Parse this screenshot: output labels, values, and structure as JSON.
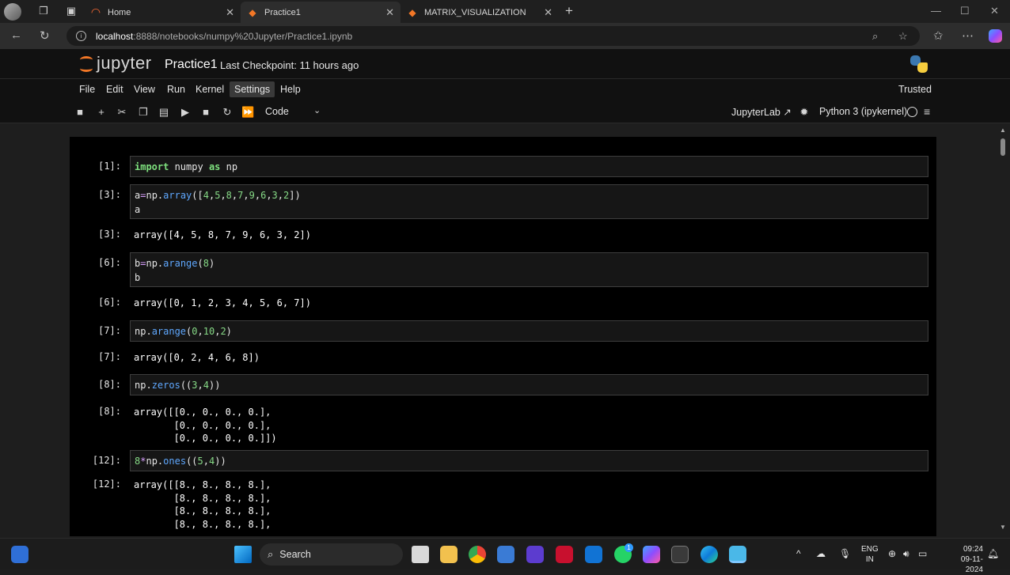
{
  "browser": {
    "tabs": [
      {
        "label": "Home",
        "icon": "edge-tab-icon"
      },
      {
        "label": "Practice1",
        "icon": "jupyter-notebook-icon"
      },
      {
        "label": "MATRIX_VISUALIZATION",
        "icon": "jupyter-notebook-icon"
      }
    ],
    "url_host": "localhost",
    "url_rest": ":8888/notebooks/numpy%20Jupyter/Practice1.ipynb"
  },
  "jupyter": {
    "logo_text": "jupyter",
    "notebook_title": "Practice1",
    "checkpoint": "Last Checkpoint: 11 hours ago",
    "menu": [
      "File",
      "Edit",
      "View",
      "Run",
      "Kernel",
      "Settings",
      "Help"
    ],
    "trusted": "Trusted",
    "cell_type": "Code",
    "jupyterlab_label": "JupyterLab",
    "kernel_name": "Python 3 (ipykernel)"
  },
  "cells": [
    {
      "prompt": "[1]:",
      "code": [
        "import numpy as np"
      ],
      "out_prompt": "",
      "output": ""
    },
    {
      "prompt": "[3]:",
      "code": [
        "a=np.array([4,5,8,7,9,6,3,2])",
        "a"
      ],
      "out_prompt": "[3]:",
      "output": "array([4, 5, 8, 7, 9, 6, 3, 2])"
    },
    {
      "prompt": "[6]:",
      "code": [
        "b=np.arange(8)",
        "b"
      ],
      "out_prompt": "[6]:",
      "output": "array([0, 1, 2, 3, 4, 5, 6, 7])"
    },
    {
      "prompt": "[7]:",
      "code": [
        "np.arange(0,10,2)"
      ],
      "out_prompt": "[7]:",
      "output": "array([0, 2, 4, 6, 8])"
    },
    {
      "prompt": "[8]:",
      "code": [
        "np.zeros((3,4))"
      ],
      "out_prompt": "[8]:",
      "output": "array([[0., 0., 0., 0.],\n       [0., 0., 0., 0.],\n       [0., 0., 0., 0.]])"
    },
    {
      "prompt": "[12]:",
      "code": [
        "8*np.ones((5,4))"
      ],
      "out_prompt": "[12]:",
      "output": "array([[8., 8., 8., 8.],\n       [8., 8., 8., 8.],\n       [8., 8., 8., 8.],\n       [8., 8., 8., 8.],"
    }
  ],
  "taskbar": {
    "search_label": "Search",
    "lang_top": "ENG",
    "lang_bottom": "IN",
    "time": "09:24",
    "date": "09-11-2024",
    "whatsapp_badge": "1"
  }
}
